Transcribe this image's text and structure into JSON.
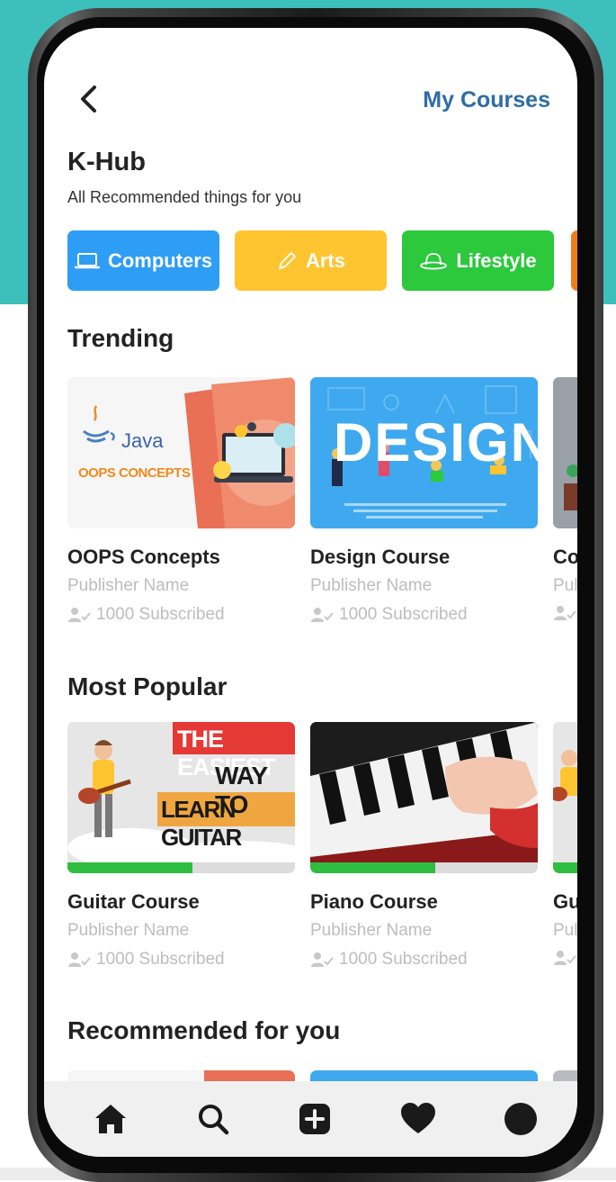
{
  "header": {
    "my_courses": "My Courses",
    "title": "K-Hub",
    "subtitle": "All Recommended things for you"
  },
  "categories": [
    {
      "label": "Computers",
      "color": "#2e9df5",
      "icon": "laptop-icon"
    },
    {
      "label": "Arts",
      "color": "#ffc530",
      "icon": "pencil-icon"
    },
    {
      "label": "Lifestyle",
      "color": "#2bc93b",
      "icon": "hat-icon"
    },
    {
      "label": "",
      "color": "#f07d1a",
      "icon": ""
    }
  ],
  "sections": {
    "trending": "Trending",
    "popular": "Most Popular",
    "recommended": "Recommended for you"
  },
  "trending": [
    {
      "title": "OOPS Concepts",
      "publisher": "Publisher Name",
      "subscribed": "1000 Subscribed",
      "thumb_java": "Java",
      "thumb_oops": "OOPS CONCEPTS"
    },
    {
      "title": "Design Course",
      "publisher": "Publisher Name",
      "subscribed": "1000 Subscribed",
      "thumb_text": "DESIGN"
    },
    {
      "title": "Co",
      "publisher": "Pul",
      "subscribed": ""
    }
  ],
  "popular": [
    {
      "title": "Guitar  Course",
      "publisher": "Publisher Name",
      "subscribed": "1000 Subscribed",
      "progress": 0.55,
      "thumb_l1": "THE EASIEST",
      "thumb_l2": "WAY TO",
      "thumb_l3": "LEARN GUITAR"
    },
    {
      "title": "Piano Course",
      "publisher": "Publisher Name",
      "subscribed": "1000 Subscribed",
      "progress": 0.55
    },
    {
      "title": "Gu",
      "publisher": "Pul",
      "subscribed": "",
      "progress": 0.3
    }
  ],
  "nav": [
    {
      "icon": "home-icon"
    },
    {
      "icon": "search-icon"
    },
    {
      "icon": "add-icon"
    },
    {
      "icon": "heart-icon"
    },
    {
      "icon": "profile-icon"
    }
  ],
  "colors": {
    "teal": "#3dbfbc",
    "link": "#2e6da4",
    "progress": "#2ebd3e"
  }
}
